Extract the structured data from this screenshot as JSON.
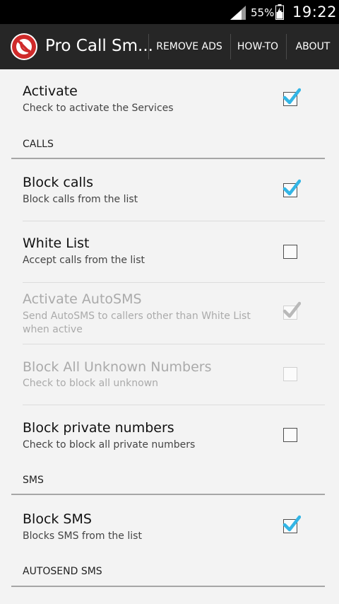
{
  "status_bar": {
    "battery": "55%",
    "time": "19:22"
  },
  "action_bar": {
    "title": "Pro Call Sm...",
    "items": [
      "REMOVE ADS",
      "HOW-TO",
      "ABOUT"
    ]
  },
  "preferences": {
    "activate": {
      "title": "Activate",
      "summary": "Check to activate the Services",
      "checked": true
    },
    "calls_category": "CALLS",
    "block_calls": {
      "title": "Block calls",
      "summary": "Block calls from the list",
      "checked": true
    },
    "white_list": {
      "title": "White List",
      "summary": "Accept calls from the list",
      "checked": false
    },
    "activate_autosms": {
      "title": "Activate AutoSMS",
      "summary": "Send AutoSMS to callers other than White List when active",
      "checked": true,
      "enabled": false
    },
    "block_unknown": {
      "title": "Block All Unknown Numbers",
      "summary": "Check to block all unknown",
      "checked": false,
      "enabled": false
    },
    "block_private": {
      "title": "Block private numbers",
      "summary": "Check to block all private numbers",
      "checked": false
    },
    "sms_category": "SMS",
    "block_sms": {
      "title": "Block SMS",
      "summary": "Blocks SMS from the list",
      "checked": true
    },
    "autosend_category": "AUTOSEND SMS"
  },
  "colors": {
    "check": "#33b5e5",
    "check_disabled": "#b9b9b9",
    "action_bar": "#262626"
  }
}
